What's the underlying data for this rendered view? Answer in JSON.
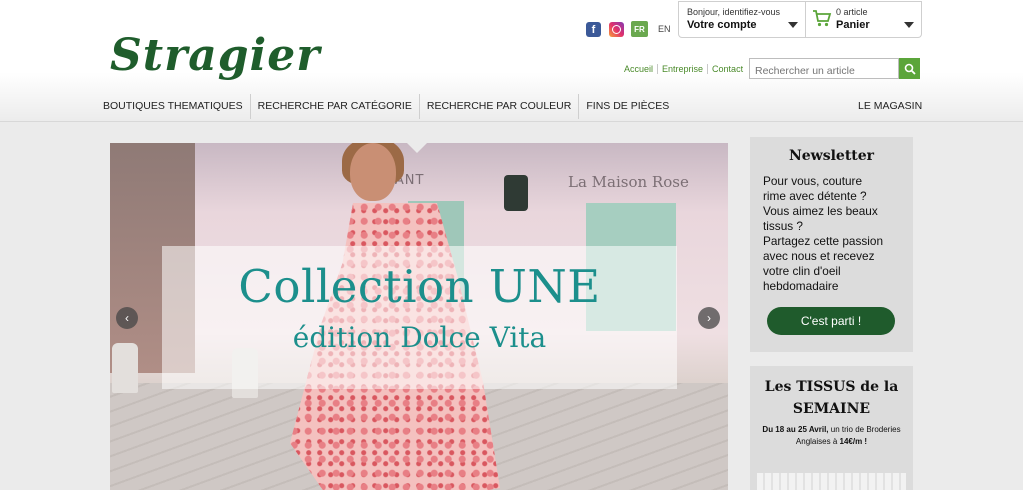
{
  "header": {
    "logo_text": "Stragier",
    "social": {
      "facebook": "f",
      "instagram": ""
    },
    "languages": {
      "active": "FR",
      "other": "EN"
    },
    "account": {
      "greeting": "Bonjour, identifiez-vous",
      "label": "Votre compte"
    },
    "cart": {
      "count_text": "0 article",
      "label": "Panier"
    },
    "top_links": [
      "Accueil",
      "Entreprise",
      "Contact"
    ],
    "search": {
      "placeholder": "Rechercher un article"
    },
    "nav": [
      "BOUTIQUES THEMATIQUES",
      "RECHERCHE PAR CATÉGORIE",
      "RECHERCHE PAR COULEUR",
      "FINS DE PIÈCES"
    ],
    "nav_right": "LE MAGASIN"
  },
  "hero": {
    "title": "Collection UNE",
    "subtitle": "édition Dolce Vita",
    "sign_left": "AURANT",
    "sign_right": "La Maison Rose",
    "prev": "‹",
    "next": "›"
  },
  "newsletter": {
    "title": "Newsletter",
    "lines": [
      "Pour vous, couture",
      "rime avec détente ?",
      "Vous aimez les beaux",
      "tissus ?",
      "Partagez cette passion",
      "avec nous et recevez",
      "votre clin d'oeil",
      "hebdomadaire"
    ],
    "button": "C'est parti !"
  },
  "tissus": {
    "title_line1": "Les TISSUS de la",
    "title_line2": "SEMAINE",
    "date_text": "Du 18 au 25 Avril,",
    "desc_text": " un trio de Broderies Anglaises à ",
    "price": "14€/m !"
  },
  "colors": {
    "brand_green": "#1f5b2c",
    "accent_green": "#5ba53a",
    "teal": "#1c8f8c"
  }
}
